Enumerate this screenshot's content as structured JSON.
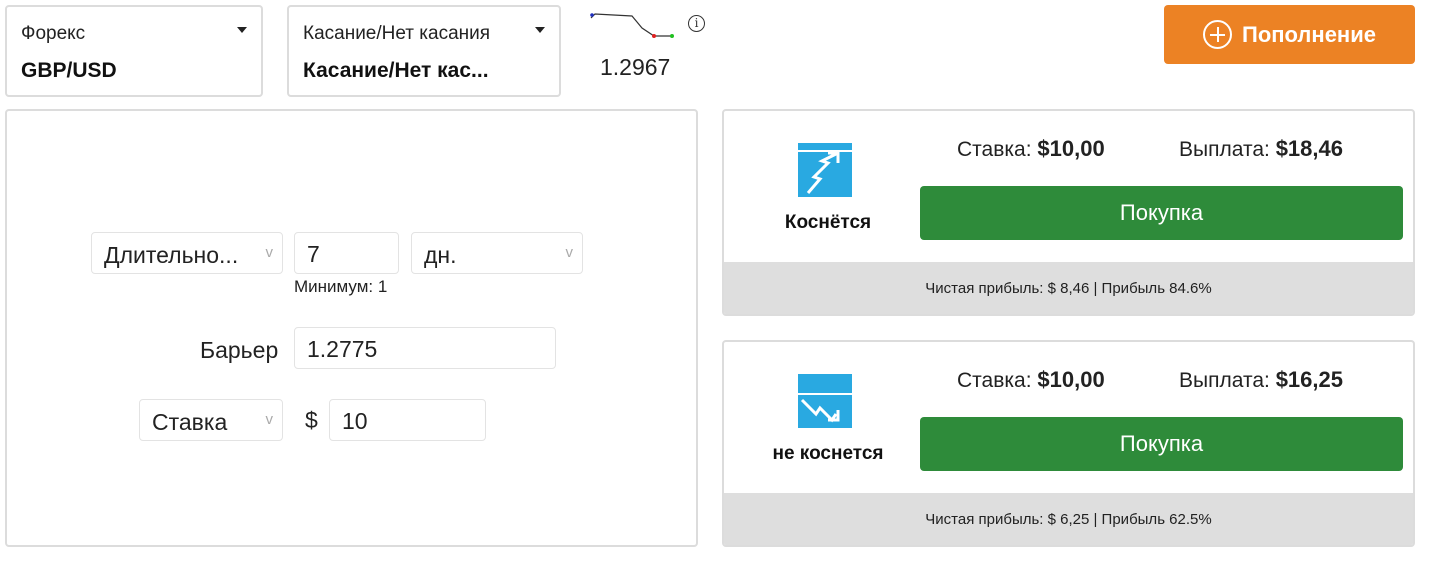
{
  "market": {
    "label": "Форекс",
    "value": "GBP/USD"
  },
  "trade_type": {
    "label": "Касание/Нет касания",
    "value": "Касание/Нет кас..."
  },
  "quote": {
    "price": "1.2967",
    "info_icon": "info-icon"
  },
  "deposit": {
    "label": "Пополнение",
    "icon": "plus-circle-icon"
  },
  "form": {
    "duration_select": "Длительно...",
    "duration_value": "7",
    "duration_unit": "дн.",
    "minimum_hint": "Минимум: 1",
    "barrier_label": "Барьер",
    "barrier_value": "1.2775",
    "stake_select": "Ставка",
    "currency_symbol": "$",
    "stake_value": "10"
  },
  "contracts": [
    {
      "direction": "Коснётся",
      "icon": "touch-up-icon",
      "stake_label": "Ставка:",
      "stake_value": "$10,00",
      "payout_label": "Выплата:",
      "payout_value": "$18,46",
      "buy_label": "Покупка",
      "summary": "Чистая прибыль: $ 8,46 | Прибыль 84.6%"
    },
    {
      "direction": "не коснется",
      "icon": "no-touch-down-icon",
      "stake_label": "Ставка:",
      "stake_value": "$10,00",
      "payout_label": "Выплата:",
      "payout_value": "$16,25",
      "buy_label": "Покупка",
      "summary": "Чистая прибыль: $ 6,25 | Прибыль 62.5%"
    }
  ],
  "colors": {
    "accent": "#ec8224",
    "buy": "#2e8b3a",
    "icon_blue": "#29a9e1"
  }
}
